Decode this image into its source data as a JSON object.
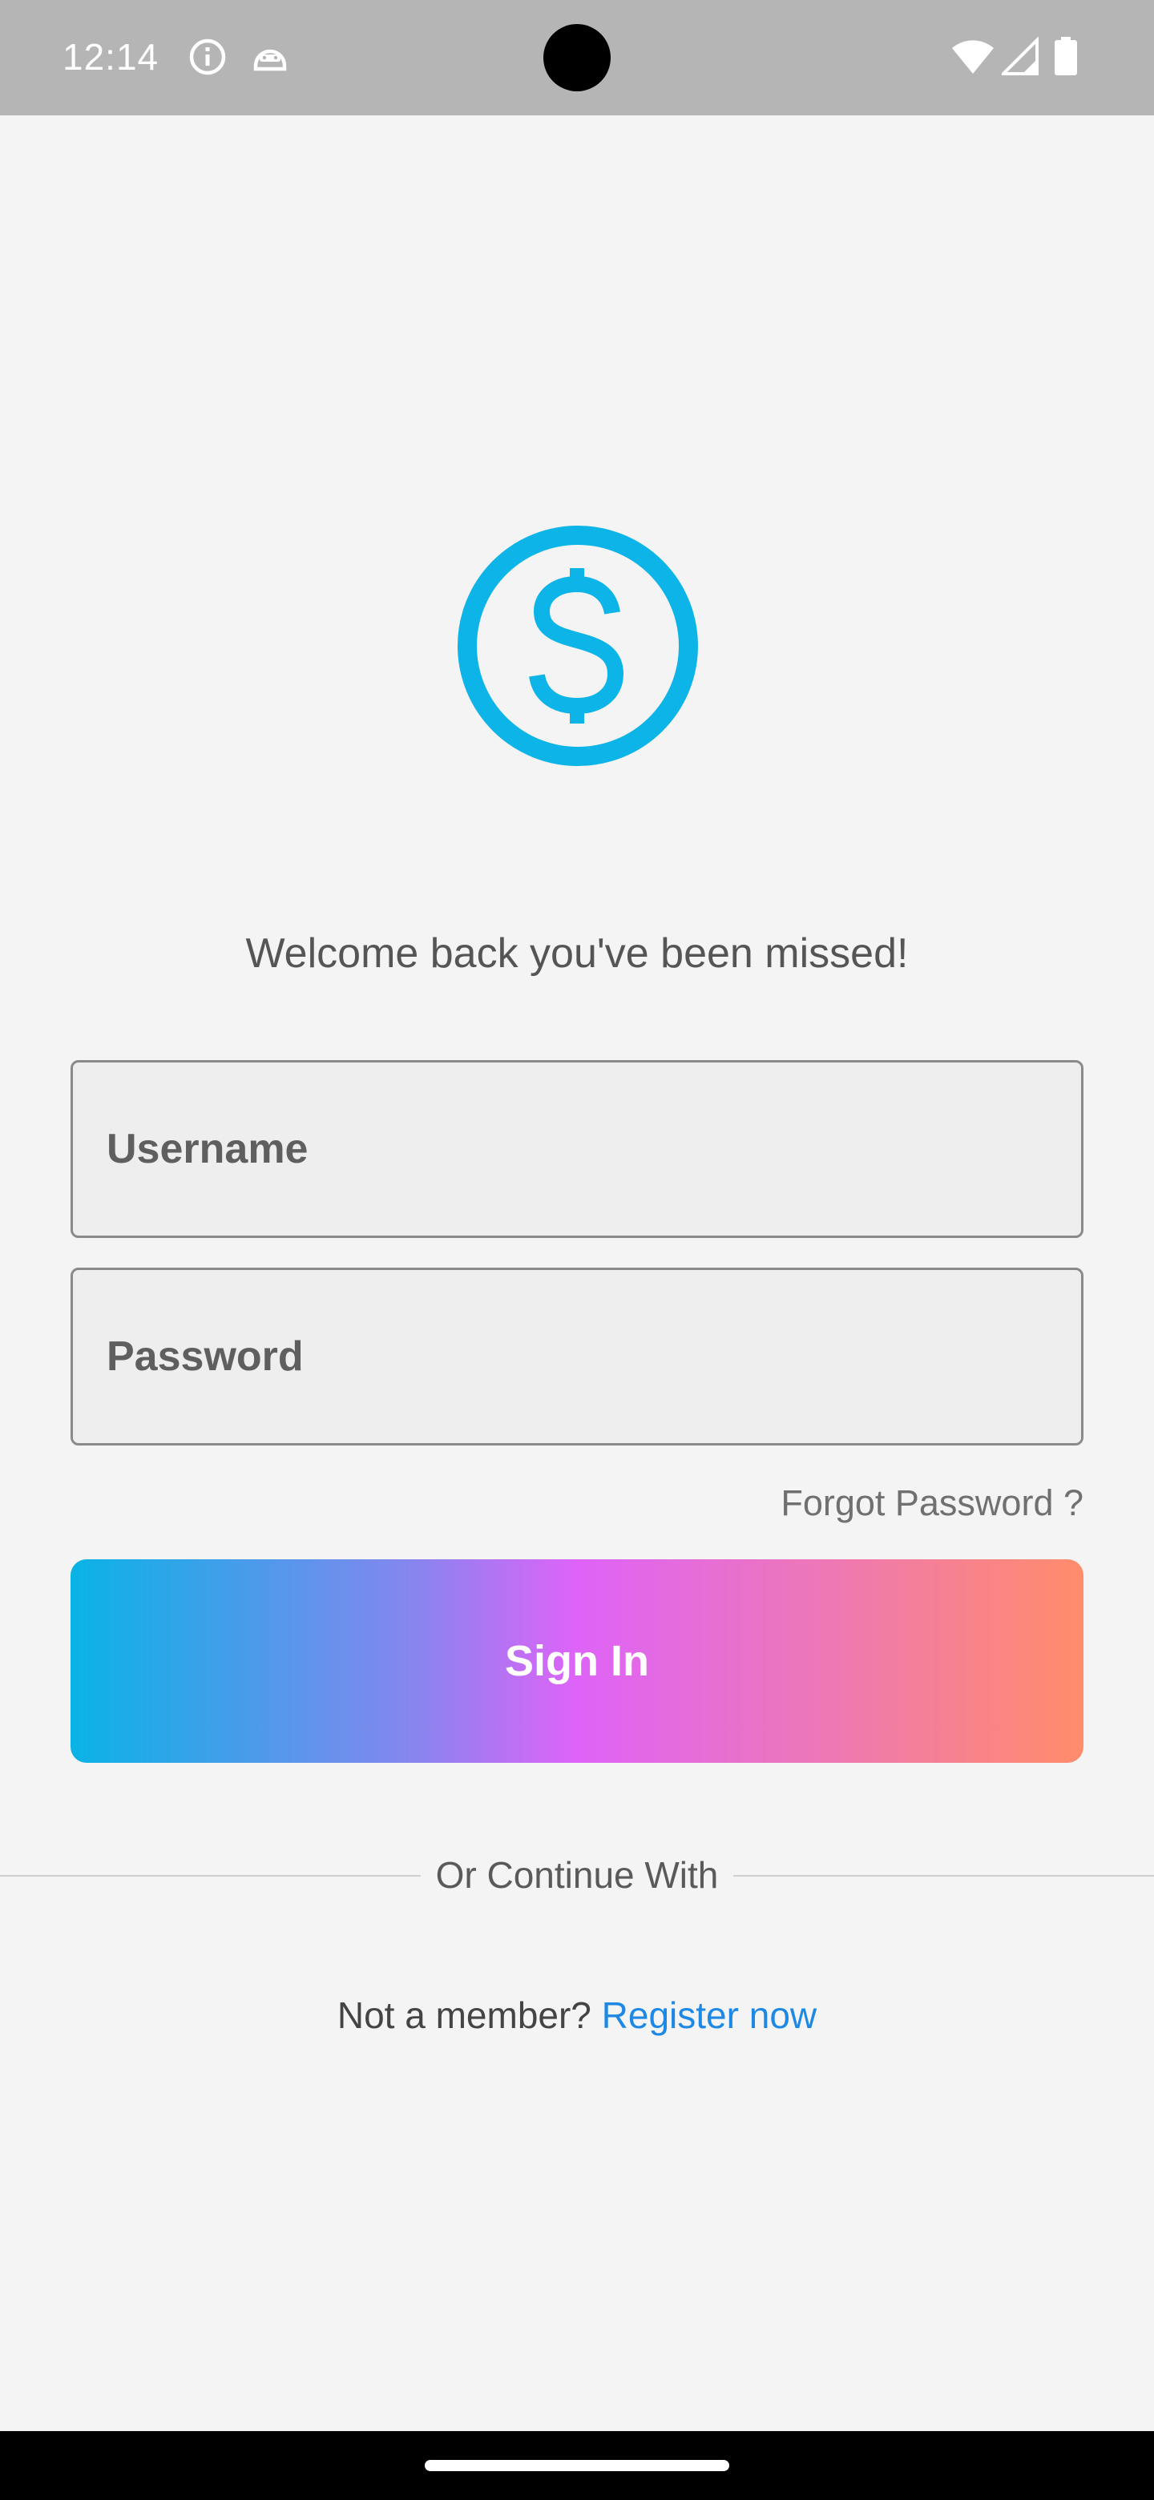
{
  "status_bar": {
    "time": "12:14",
    "icons": [
      "info-icon",
      "android-debug-icon",
      "wifi-icon",
      "signal-icon",
      "battery-icon"
    ]
  },
  "colors": {
    "logo": "#0db4e8",
    "link": "#1e88e5",
    "gradient": [
      "#09b3e6",
      "#de63f8",
      "#ff8c6b"
    ]
  },
  "logo": {
    "icon": "dollar-circle-icon"
  },
  "login": {
    "welcome_text": "Welcome back you've been missed!",
    "username_placeholder": "Username",
    "username_value": "",
    "password_placeholder": "Password",
    "password_value": "",
    "forgot_password": "Forgot Password ?",
    "sign_in_label": "Sign In",
    "divider_text": "Or Continue With",
    "not_member_text": "Not a member?",
    "register_link": "Register now"
  }
}
